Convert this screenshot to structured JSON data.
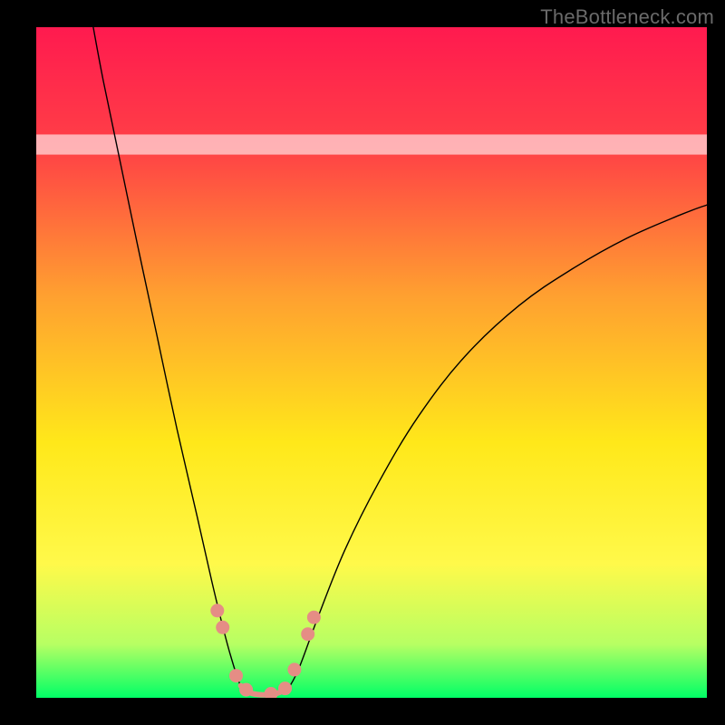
{
  "watermark": "TheBottleneck.com",
  "chart_data": {
    "type": "line",
    "title": "",
    "xlabel": "",
    "ylabel": "",
    "xlim": [
      0,
      100
    ],
    "ylim": [
      0,
      100
    ],
    "background_gradient": {
      "stops": [
        {
          "offset": 0.0,
          "color": "#ff1a4f"
        },
        {
          "offset": 0.18,
          "color": "#ff4046"
        },
        {
          "offset": 0.4,
          "color": "#ffa030"
        },
        {
          "offset": 0.62,
          "color": "#ffe81a"
        },
        {
          "offset": 0.8,
          "color": "#fff94a"
        },
        {
          "offset": 0.92,
          "color": "#b7ff63"
        },
        {
          "offset": 1.0,
          "color": "#00ff66"
        }
      ]
    },
    "white_band": {
      "y_from": 81,
      "y_to": 84,
      "alpha": 0.6
    },
    "series": [
      {
        "name": "left-branch",
        "type": "curve",
        "stroke": "#000000",
        "stroke_width": 1.4,
        "points": [
          {
            "x": 8.5,
            "y": 100.0
          },
          {
            "x": 10.0,
            "y": 92.0
          },
          {
            "x": 12.5,
            "y": 80.0
          },
          {
            "x": 15.0,
            "y": 68.0
          },
          {
            "x": 18.0,
            "y": 54.0
          },
          {
            "x": 21.0,
            "y": 40.0
          },
          {
            "x": 24.0,
            "y": 27.0
          },
          {
            "x": 26.5,
            "y": 16.0
          },
          {
            "x": 28.5,
            "y": 8.0
          },
          {
            "x": 30.0,
            "y": 3.0
          },
          {
            "x": 31.0,
            "y": 0.5
          }
        ]
      },
      {
        "name": "right-branch",
        "type": "curve",
        "stroke": "#000000",
        "stroke_width": 1.4,
        "points": [
          {
            "x": 37.0,
            "y": 0.5
          },
          {
            "x": 39.0,
            "y": 4.0
          },
          {
            "x": 42.0,
            "y": 12.0
          },
          {
            "x": 46.0,
            "y": 22.0
          },
          {
            "x": 51.0,
            "y": 32.0
          },
          {
            "x": 57.0,
            "y": 42.0
          },
          {
            "x": 64.0,
            "y": 51.0
          },
          {
            "x": 72.0,
            "y": 58.5
          },
          {
            "x": 80.0,
            "y": 64.0
          },
          {
            "x": 88.0,
            "y": 68.5
          },
          {
            "x": 96.0,
            "y": 72.0
          },
          {
            "x": 100.0,
            "y": 73.5
          }
        ]
      },
      {
        "name": "valley-floor",
        "type": "curve",
        "stroke": "#e58d85",
        "stroke_width": 6.0,
        "points": [
          {
            "x": 30.5,
            "y": 1.8
          },
          {
            "x": 31.5,
            "y": 0.9
          },
          {
            "x": 33.0,
            "y": 0.5
          },
          {
            "x": 35.0,
            "y": 0.5
          },
          {
            "x": 36.5,
            "y": 0.9
          },
          {
            "x": 37.5,
            "y": 1.8
          }
        ]
      },
      {
        "name": "markers",
        "type": "points",
        "fill": "#e58d85",
        "radius": 7.5,
        "points": [
          {
            "x": 27.0,
            "y": 13.0
          },
          {
            "x": 27.8,
            "y": 10.5
          },
          {
            "x": 29.8,
            "y": 3.3
          },
          {
            "x": 31.3,
            "y": 1.2
          },
          {
            "x": 35.0,
            "y": 0.6
          },
          {
            "x": 37.1,
            "y": 1.4
          },
          {
            "x": 38.5,
            "y": 4.2
          },
          {
            "x": 40.5,
            "y": 9.5
          },
          {
            "x": 41.4,
            "y": 12.0
          }
        ]
      }
    ]
  }
}
